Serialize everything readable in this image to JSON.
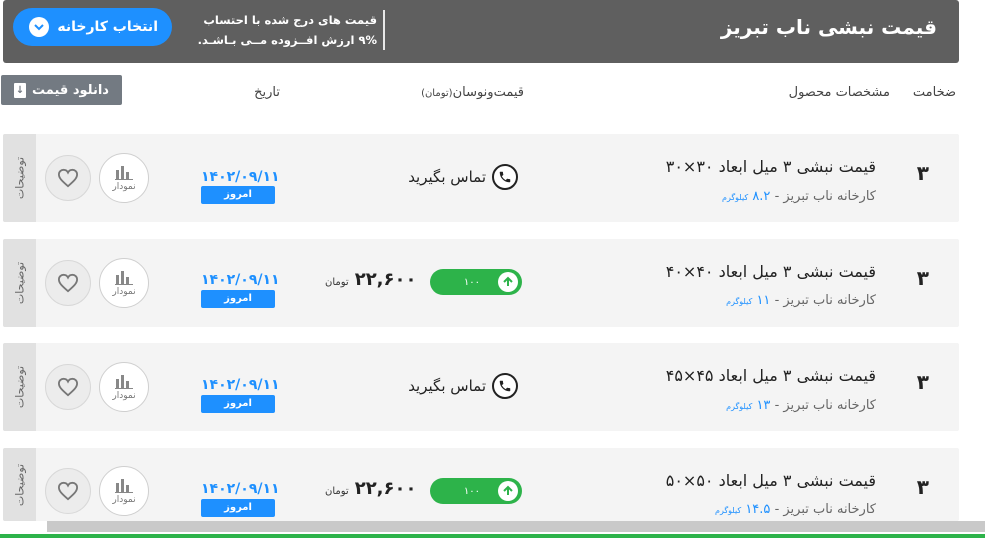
{
  "header": {
    "title": "قیمت نبشی ناب تبریز",
    "note_line1": "قیمت های درج شده با احتساب",
    "note_line2": "۹% ارزش افــزوده مــی بـاشـد.",
    "factory_button": "انتخاب کارخانه"
  },
  "columns": {
    "thickness": "ضخامت",
    "specs": "مشخصات محصول",
    "price": "قیمت‌ونوسان",
    "price_unit": "(تومان)",
    "date": "تاریخ"
  },
  "download_button": "دانلود قیمت",
  "rows": [
    {
      "thickness": "۳",
      "name": "قیمت نبشی ۳ میل ابعاد ۳۰×۳۰",
      "factory": "کارخانه ناب تبریز -",
      "weight": "۸.۲",
      "weight_unit": "کیلوگرم",
      "contact": "تماس بگیرید",
      "date": "۱۴۰۲/۰۹/۱۱",
      "today": "امروز",
      "chart_label": "نمودار",
      "notes_tab": "توضیحات"
    },
    {
      "thickness": "۳",
      "name": "قیمت نبشی ۳ میل ابعاد ۴۰×۴۰",
      "factory": "کارخانه ناب تبریز -",
      "weight": "۱۱",
      "weight_unit": "کیلوگرم",
      "price": "۲۲,۶۰۰",
      "price_unit": "تومان",
      "change": "۱۰۰",
      "date": "۱۴۰۲/۰۹/۱۱",
      "today": "امروز",
      "chart_label": "نمودار",
      "notes_tab": "توضیحات"
    },
    {
      "thickness": "۳",
      "name": "قیمت نبشی ۳ میل ابعاد ۴۵×۴۵",
      "factory": "کارخانه ناب تبریز -",
      "weight": "۱۳",
      "weight_unit": "کیلوگرم",
      "contact": "تماس بگیرید",
      "date": "۱۴۰۲/۰۹/۱۱",
      "today": "امروز",
      "chart_label": "نمودار",
      "notes_tab": "توضیحات"
    },
    {
      "thickness": "۳",
      "name": "قیمت نبشی ۳ میل ابعاد ۵۰×۵۰",
      "factory": "کارخانه ناب تبریز -",
      "weight": "۱۴.۵",
      "weight_unit": "کیلوگرم",
      "price": "۲۲,۶۰۰",
      "price_unit": "تومان",
      "change": "۱۰۰",
      "date": "۱۴۰۲/۰۹/۱۱",
      "today": "امروز",
      "chart_label": "نمودار",
      "notes_tab": "توضیحات"
    }
  ],
  "colors": {
    "accent_blue": "#1e90ff",
    "header_gray": "#5f5f5f",
    "up_green": "#2db34a"
  }
}
